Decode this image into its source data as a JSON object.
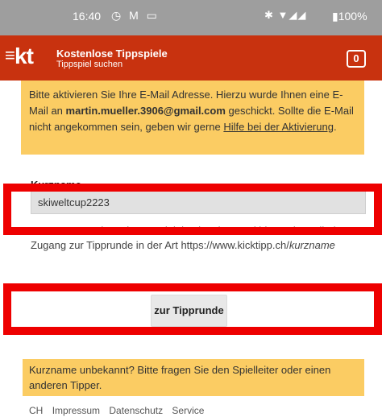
{
  "status_bar": {
    "time": "16:40",
    "left_icons": "◷ M ▭",
    "right_icons": "✱ ▼◢◢",
    "battery": "▮100%"
  },
  "app_bar": {
    "logo": "kt",
    "title": "Kostenlose Tippspiele",
    "subtitle": "Tippspiel suchen",
    "badge": "0"
  },
  "notice": {
    "text_before": "Bitte aktivieren Sie Ihre E-Mail Adresse. Hierzu wurde Ihnen eine E-Mail an ",
    "email": "martin.mueller.3906@gmail.com",
    "text_middle": " geschickt. Sollte die E-Mail nicht angekommen sein, geben wir gerne ",
    "link": "Hilfe bei der Aktivierung",
    "text_after": "."
  },
  "form": {
    "label": "Kurzname",
    "value": "skiweltcup2223",
    "hint": "Der Kurzname besteht aus Kleinbuchstaben und bietet einen direkten Zugang zur Tipprunde in der Art https://www.kicktipp.ch/",
    "hint_italic": "kurzname",
    "button": "zur Tipprunde"
  },
  "unknown_notice": "Kurzname unbekannt? Bitte fragen Sie den Spielleiter oder einen anderen Tipper.",
  "footer": {
    "items": [
      "CH",
      "Impressum",
      "Datenschutz",
      "Service"
    ]
  }
}
